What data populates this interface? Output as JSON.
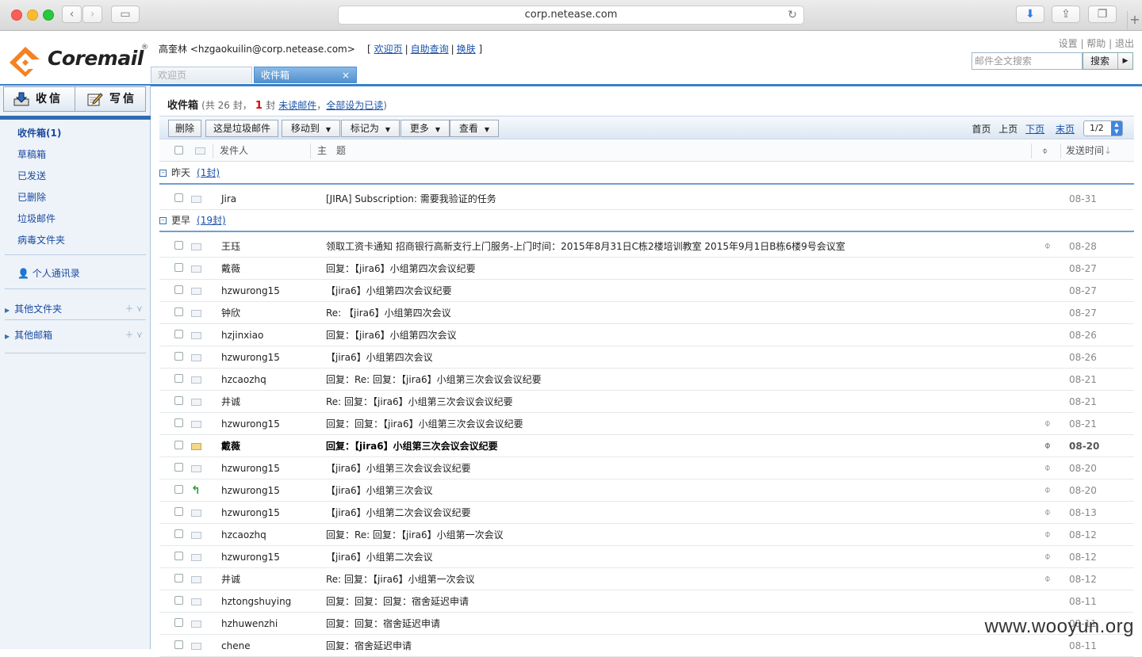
{
  "browser": {
    "url": "corp.netease.com"
  },
  "header": {
    "logo_text": "Coremail",
    "logo_reg": "®",
    "user_name": "高奎林",
    "user_email": "<hzgaokuilin@corp.netease.com>",
    "bracket_open": "[",
    "bracket_close": "]",
    "links": [
      "欢迎页",
      "自助查询",
      "换肤"
    ],
    "top_links": [
      "设置",
      "帮助",
      "退出"
    ],
    "search_placeholder": "邮件全文搜索",
    "search_button": "搜索"
  },
  "tabs": [
    {
      "label": "欢迎页",
      "active": false
    },
    {
      "label": "收件箱",
      "active": true,
      "close": "×"
    }
  ],
  "sidebar": {
    "receive": "收信",
    "write": "写信",
    "folders": [
      "收件箱(1)",
      "草稿箱",
      "已发送",
      "已删除",
      "垃圾邮件",
      "病毒文件夹"
    ],
    "contacts": "个人通讯录",
    "groups": [
      "其他文件夹",
      "其他邮箱"
    ]
  },
  "main": {
    "title": "收件箱",
    "count_text": "(共 26 封，",
    "unread_num": "1",
    "unread_text": "封",
    "unread_link": "未读邮件",
    "comma": "，",
    "mark_all_link": "全部设为已读",
    "close_paren": ")",
    "toolbar": {
      "delete": "删除",
      "spam": "这是垃圾邮件",
      "move": "移动到",
      "mark": "标记为",
      "more": "更多",
      "view": "查看"
    },
    "pager": {
      "first": "首页",
      "prev": "上页",
      "next": "下页",
      "last": "末页",
      "page": "1/2"
    },
    "columns": {
      "sender": "发件人",
      "subject": "主　题",
      "date": "发送时间"
    },
    "groups": [
      {
        "label": "昨天",
        "count": "(1封)"
      },
      {
        "label": "更早",
        "count": "(19封)"
      }
    ],
    "rows": [
      {
        "sender": "Jira",
        "subject": "[JIRA] Subscription: 需要我验证的任务",
        "date": "08-31",
        "attach": false,
        "icon": "read"
      },
      {
        "sender": "王珏",
        "subject": "领取工资卡通知 招商银行高新支行上门服务-上门时间：2015年8月31日C栋2楼培训教室  2015年9月1日B栋6楼9号会议室",
        "date": "08-28",
        "attach": true,
        "icon": "read"
      },
      {
        "sender": "戴薇",
        "subject": "回复：【jira6】小组第四次会议纪要",
        "date": "08-27",
        "attach": false,
        "icon": "read"
      },
      {
        "sender": "hzwurong15",
        "subject": "【jira6】小组第四次会议纪要",
        "date": "08-27",
        "attach": false,
        "icon": "read"
      },
      {
        "sender": "钟欣",
        "subject": "Re: 【jira6】小组第四次会议",
        "date": "08-27",
        "attach": false,
        "icon": "read"
      },
      {
        "sender": "hzjinxiao",
        "subject": "回复：【jira6】小组第四次会议",
        "date": "08-26",
        "attach": false,
        "icon": "read"
      },
      {
        "sender": "hzwurong15",
        "subject": "【jira6】小组第四次会议",
        "date": "08-26",
        "attach": false,
        "icon": "read"
      },
      {
        "sender": "hzcaozhq",
        "subject": "回复：Re: 回复：【jira6】小组第三次会议会议纪要",
        "date": "08-21",
        "attach": false,
        "icon": "read"
      },
      {
        "sender": "井诚",
        "subject": "Re: 回复：【jira6】小组第三次会议会议纪要",
        "date": "08-21",
        "attach": false,
        "icon": "read"
      },
      {
        "sender": "hzwurong15",
        "subject": "回复：回复：【jira6】小组第三次会议会议纪要",
        "date": "08-21",
        "attach": true,
        "icon": "read"
      },
      {
        "sender": "戴薇",
        "subject": "回复：【jira6】小组第三次会议会议纪要",
        "date": "08-20",
        "attach": true,
        "icon": "unread",
        "bold": true
      },
      {
        "sender": "hzwurong15",
        "subject": "【jira6】小组第三次会议会议纪要",
        "date": "08-20",
        "attach": true,
        "icon": "read"
      },
      {
        "sender": "hzwurong15",
        "subject": "【jira6】小组第三次会议",
        "date": "08-20",
        "attach": true,
        "icon": "replied"
      },
      {
        "sender": "hzwurong15",
        "subject": "【jira6】小组第二次会议会议纪要",
        "date": "08-13",
        "attach": true,
        "icon": "read"
      },
      {
        "sender": "hzcaozhq",
        "subject": "回复：Re: 回复：【jira6】小组第一次会议",
        "date": "08-12",
        "attach": true,
        "icon": "read"
      },
      {
        "sender": "hzwurong15",
        "subject": "【jira6】小组第二次会议",
        "date": "08-12",
        "attach": true,
        "icon": "read"
      },
      {
        "sender": "井诚",
        "subject": "Re: 回复：【jira6】小组第一次会议",
        "date": "08-12",
        "attach": true,
        "icon": "read"
      },
      {
        "sender": "hztongshuying",
        "subject": "回复：回复：回复：宿舍延迟申请",
        "date": "08-11",
        "attach": false,
        "icon": "read"
      },
      {
        "sender": "hzhuwenzhi",
        "subject": "回复：回复：宿舍延迟申请",
        "date": "08-11",
        "attach": false,
        "icon": "read"
      },
      {
        "sender": "chene",
        "subject": "回复：宿舍延迟申请",
        "date": "08-11",
        "attach": false,
        "icon": "read"
      }
    ]
  },
  "watermark": "www.wooyun.org"
}
